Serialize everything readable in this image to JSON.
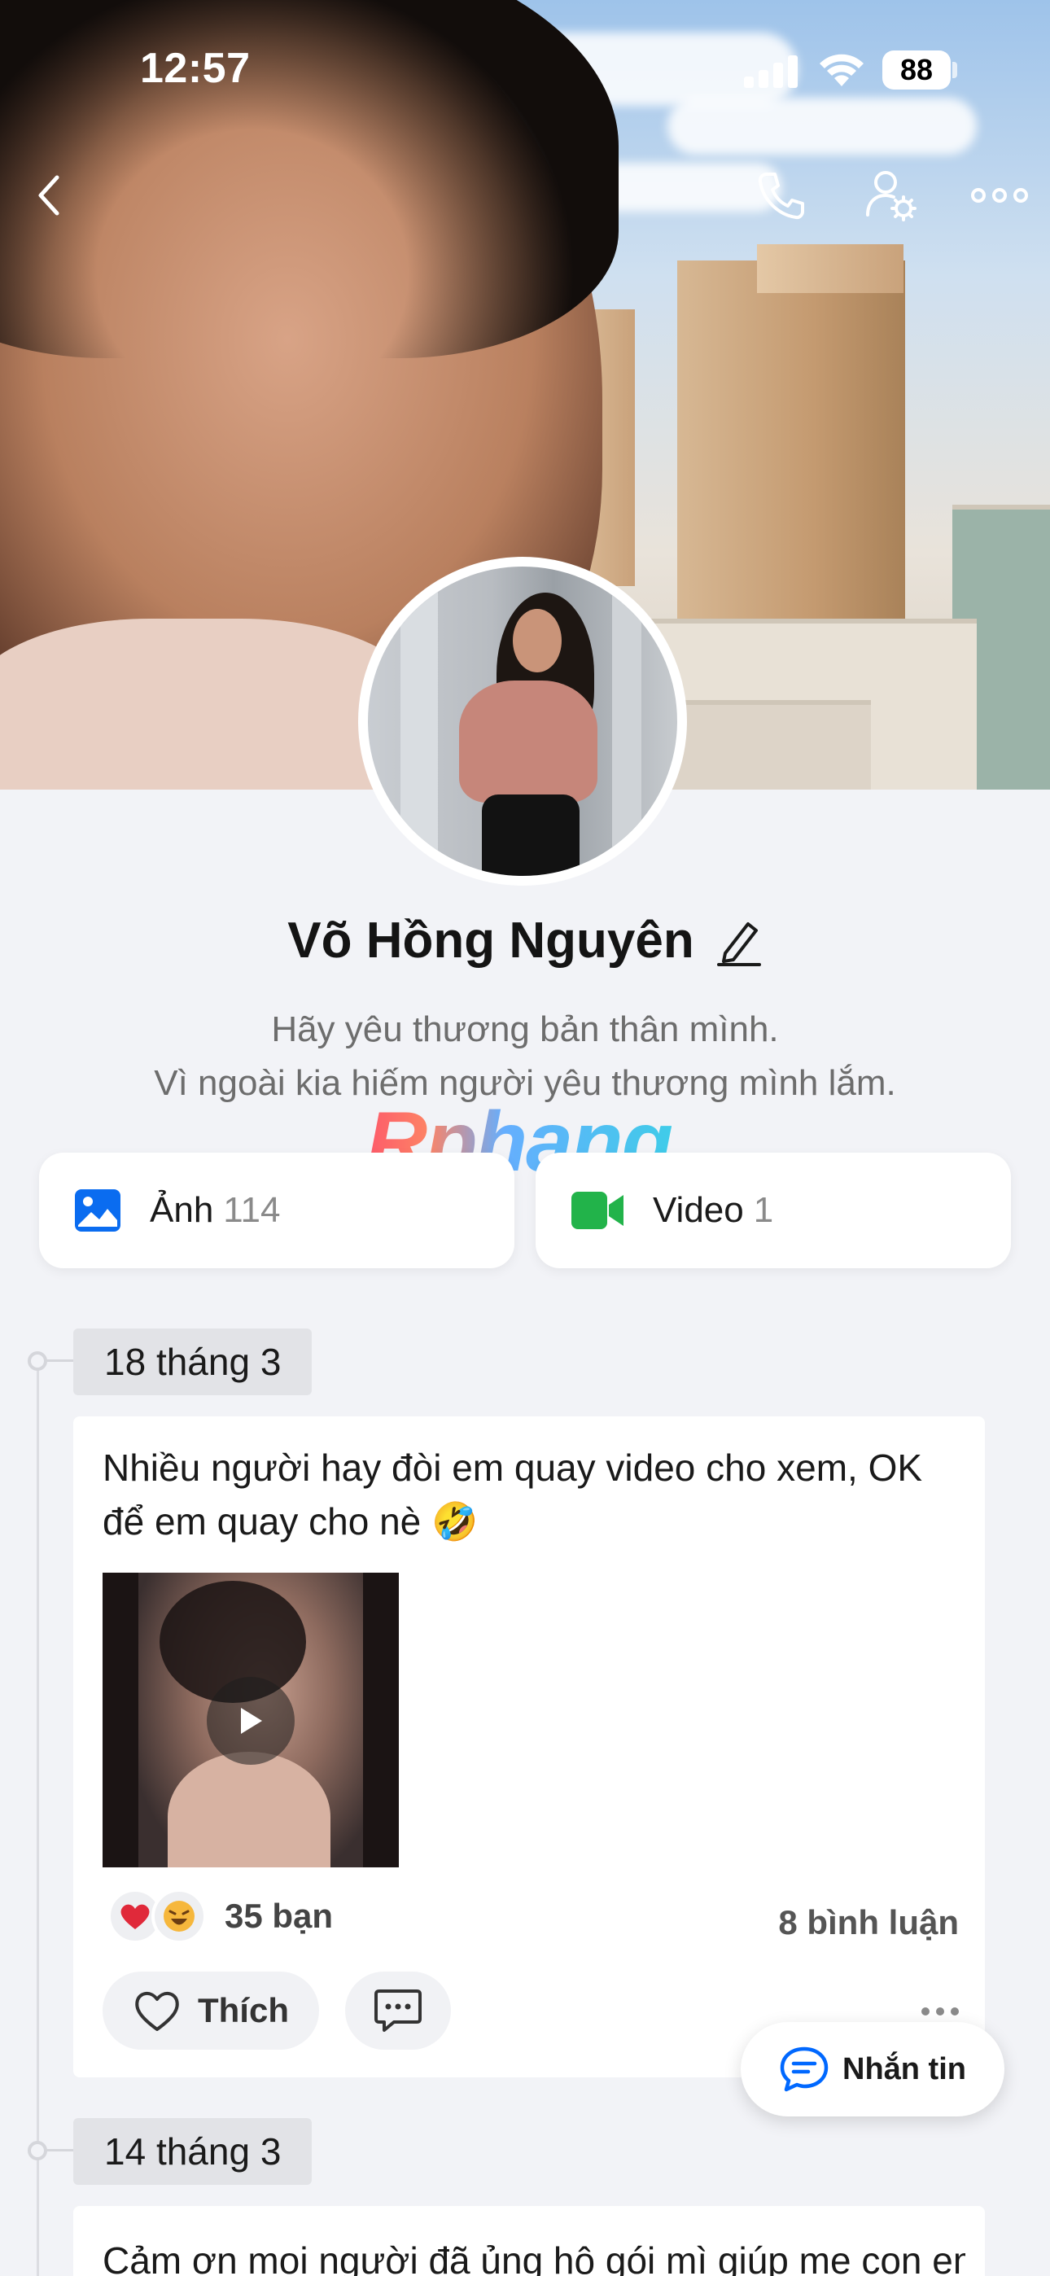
{
  "status_bar": {
    "time": "12:57",
    "battery": "88"
  },
  "profile": {
    "name": "Võ Hồng Nguyên",
    "bio_line1": "Hãy yêu thương bản thân mình.",
    "bio_line2": "Vì ngoài kia hiếm người yêu thương mình lắm."
  },
  "watermark": "Rphang",
  "media": {
    "photos_label": "Ảnh",
    "photos_count": "114",
    "videos_label": "Video",
    "videos_count": "1"
  },
  "timeline": [
    {
      "date": "18 tháng 3",
      "text": "Nhiều người hay đòi em quay video cho xem, OK để em quay cho nè 🤣",
      "reactions": [
        "heart",
        "laugh"
      ],
      "reaction_count": "35 bạn",
      "comment_count": "8 bình luận",
      "like_label": "Thích"
    },
    {
      "date": "14 tháng 3",
      "text": "Cảm ơn mọi người đã ủng hộ gói mì giúp mẹ con em"
    }
  ],
  "fab": {
    "label": "Nhắn tin"
  },
  "colors": {
    "accent_blue": "#0068ff",
    "video_green": "#22b34a",
    "heart_red": "#e0293a"
  },
  "icons": [
    "back-icon",
    "phone-icon",
    "user-settings-icon",
    "more-icon",
    "photo-icon",
    "video-icon",
    "pencil-icon",
    "play-icon",
    "heart-outline-icon",
    "comment-icon",
    "message-icon"
  ]
}
